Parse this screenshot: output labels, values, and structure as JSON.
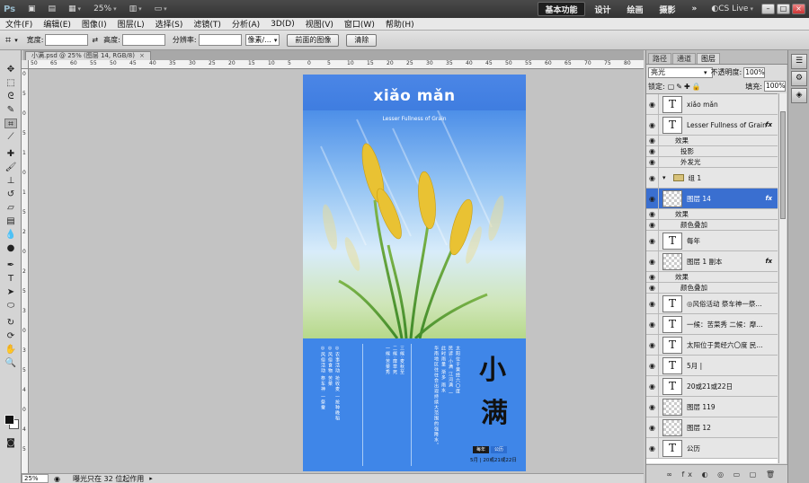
{
  "titlebar": {
    "logo": "Ps",
    "zoom": "25%",
    "workspaces": [
      "基本功能",
      "设计",
      "绘画",
      "摄影"
    ],
    "more": "»",
    "cslive": "CS Live",
    "win_min": "–",
    "win_max": "□",
    "win_close": "×"
  },
  "menu": [
    "文件(F)",
    "编辑(E)",
    "图像(I)",
    "图层(L)",
    "选择(S)",
    "滤镜(T)",
    "分析(A)",
    "3D(D)",
    "视图(V)",
    "窗口(W)",
    "帮助(H)"
  ],
  "options": {
    "width_label": "宽度:",
    "width_value": "",
    "swap_icon": "⇄",
    "height_label": "高度:",
    "height_value": "",
    "resolution_label": "分辨率:",
    "resolution_value": "",
    "unit": "像素/...",
    "front_image": "前面的图像",
    "clear": "清除"
  },
  "document": {
    "tab_title": "小满.psd @ 25% (图层 14, RGB/8)",
    "tab_close": "×",
    "zoom": "25%",
    "status": "曝光只在 32 位起作用"
  },
  "ruler": {
    "h_labels": [
      "50",
      "65",
      "60",
      "55",
      "50",
      "45",
      "40",
      "35",
      "30",
      "25",
      "20",
      "15",
      "10",
      "5",
      "0",
      "5",
      "10",
      "15",
      "20",
      "25",
      "30",
      "35",
      "40",
      "45",
      "50",
      "55",
      "60",
      "65",
      "70",
      "75",
      "80"
    ],
    "v_labels": [
      "0",
      "5",
      "0",
      "5",
      "1",
      "0",
      "1",
      "5",
      "2",
      "0",
      "2",
      "5",
      "3",
      "0",
      "3",
      "5",
      "4",
      "0",
      "4",
      "5"
    ]
  },
  "artwork": {
    "title": "xiǎo mǎn",
    "subtitle": "Lesser Fullness of Grain",
    "char1": "小",
    "char2": "满",
    "col_left": "◎风俗活动 祭车神 一祭蚕",
    "col_left2": "◎风俗食物 苦菜",
    "col_left3": "◎农事活动 抢收麦 一抢种晚稻",
    "col_mid1": "一候:苦菜秀",
    "col_mid2": "二候:靡草死",
    "col_mid3": "三候:麦秋至",
    "col_right1": "太阳位于黄经六〇度",
    "col_right2": "民谚:小满 江河满 一",
    "col_right3": "此时雨量 渐多 雨水",
    "col_right4": "华南地区往往会出现持续大范围的强降水。",
    "badge1": "每年",
    "badge2": "公历",
    "date": "5月 | 20或21或22日"
  },
  "layers": {
    "tabs": [
      "路径",
      "通道",
      "图层"
    ],
    "blend_mode": "亮光",
    "opacity_label": "不透明度:",
    "opacity": "100%",
    "lock_label": "锁定:",
    "fill_label": "填充:",
    "fill": "100%",
    "items": [
      {
        "kind": "text",
        "name": "xiǎo mǎn",
        "fx": ""
      },
      {
        "kind": "text",
        "name": "Lesser Fullness of Grain",
        "fx": "fx"
      },
      {
        "kind": "sub",
        "name": "效果"
      },
      {
        "kind": "sub2",
        "name": "投影"
      },
      {
        "kind": "sub2",
        "name": "外发光"
      },
      {
        "kind": "group",
        "name": "组 1"
      },
      {
        "kind": "raster",
        "name": "图层 14",
        "fx": "fx",
        "selected": true
      },
      {
        "kind": "sub",
        "name": "效果"
      },
      {
        "kind": "sub2",
        "name": "颜色叠加"
      },
      {
        "kind": "text",
        "name": "每年",
        "fx": ""
      },
      {
        "kind": "raster",
        "name": "图层 1 副本",
        "fx": "fx"
      },
      {
        "kind": "sub",
        "name": "效果"
      },
      {
        "kind": "sub2",
        "name": "颜色叠加"
      },
      {
        "kind": "text",
        "name": "◎风俗活动 祭车神一祭...",
        "fx": ""
      },
      {
        "kind": "text",
        "name": "一候：苦菜秀 二候：靡...",
        "fx": ""
      },
      {
        "kind": "text",
        "name": "太阳位于黄经六〇度 民...",
        "fx": ""
      },
      {
        "kind": "text",
        "name": "5月 |",
        "fx": ""
      },
      {
        "kind": "text",
        "name": "20或21或22日",
        "fx": ""
      },
      {
        "kind": "raster",
        "name": "图层 119",
        "fx": ""
      },
      {
        "kind": "raster",
        "name": "图层 12",
        "fx": ""
      },
      {
        "kind": "text",
        "name": "公历",
        "fx": ""
      }
    ],
    "bottom_icons": "∞ fx ◐ ◎ ▭ ▢ 🗑"
  },
  "colors": {
    "accent": "#3a6fd0",
    "art_blue": "#3f86e8"
  }
}
